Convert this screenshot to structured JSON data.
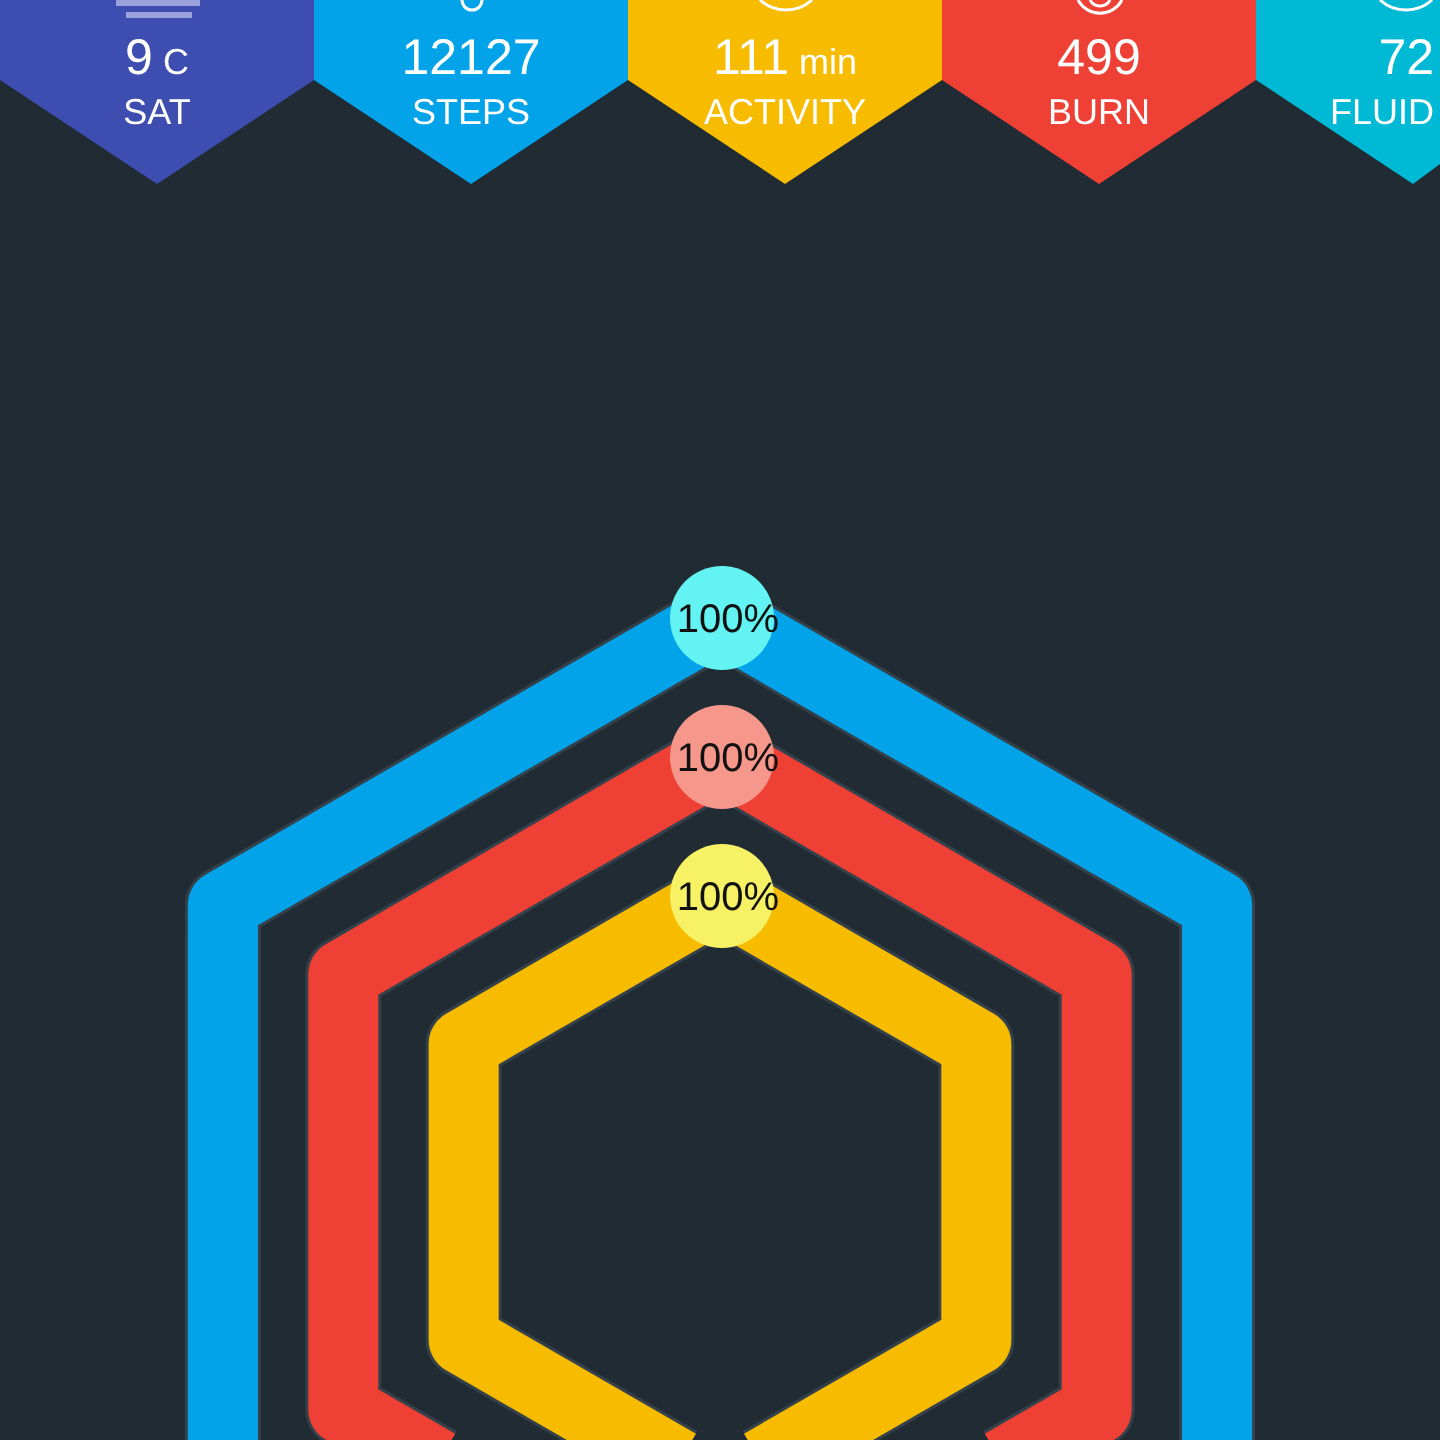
{
  "tiles": [
    {
      "value": "9",
      "unit": "C",
      "label": "SAT",
      "color": "#3d4db0"
    },
    {
      "value": "12127",
      "label": "STEPS",
      "color": "#03a3ea"
    },
    {
      "value": "111",
      "unit": "min",
      "label": "ACTIVITY",
      "color": "#f7bb00"
    },
    {
      "value": "499",
      "label": "BURN",
      "color": "#ee4035"
    },
    {
      "value": "72",
      "label": "FLUID",
      "color": "#00b9d4"
    }
  ],
  "rings": [
    {
      "label": "100%",
      "level": 1,
      "color": "#03a3ea"
    },
    {
      "label": "100%",
      "level": 1,
      "color": "#ee4035"
    },
    {
      "label": "100%",
      "level": 1,
      "color": "#f7bb00"
    }
  ]
}
